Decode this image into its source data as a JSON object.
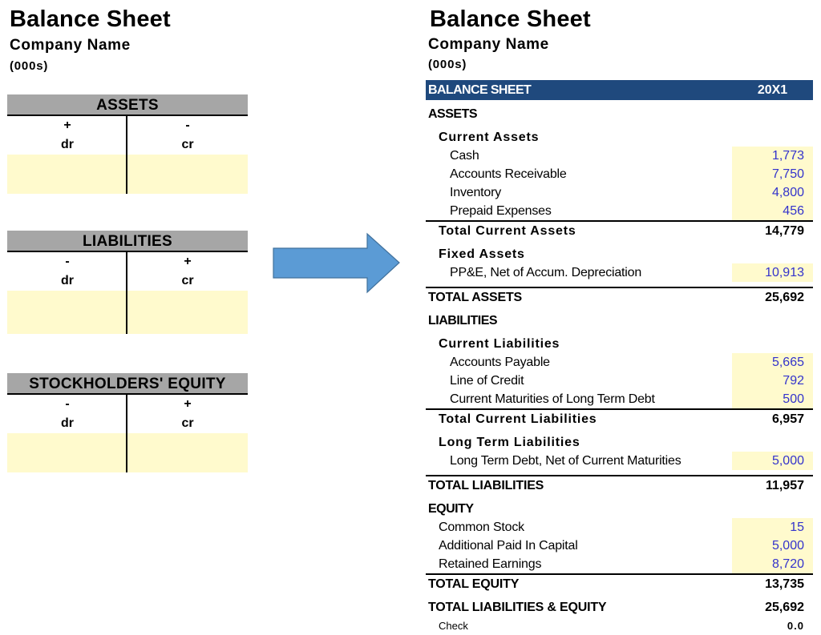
{
  "left": {
    "title": "Balance Sheet",
    "company": "Company Name",
    "units": "(000s)",
    "t_accounts": [
      {
        "name": "ASSETS",
        "dr_sign": "+",
        "cr_sign": "-",
        "dr_label": "dr",
        "cr_label": "cr"
      },
      {
        "name": "LIABILITIES",
        "dr_sign": "-",
        "cr_sign": "+",
        "dr_label": "dr",
        "cr_label": "cr"
      },
      {
        "name": "STOCKHOLDERS' EQUITY",
        "dr_sign": "-",
        "cr_sign": "+",
        "dr_label": "dr",
        "cr_label": "cr"
      }
    ]
  },
  "arrow": {
    "icon": "right-arrow-icon",
    "color": "#5b9bd5"
  },
  "right": {
    "title": "Balance Sheet",
    "company": "Company Name",
    "units": "(000s)",
    "header": {
      "label": "BALANCE SHEET",
      "period": "20X1",
      "color": "#1f497d"
    },
    "assets": {
      "label": "ASSETS",
      "current": {
        "label": "Current Assets",
        "items": [
          {
            "label": "Cash",
            "value": "1,773"
          },
          {
            "label": "Accounts Receivable",
            "value": "7,750"
          },
          {
            "label": "Inventory",
            "value": "4,800"
          },
          {
            "label": "Prepaid Expenses",
            "value": "456"
          }
        ],
        "total_label": "Total Current Assets",
        "total_value": "14,779"
      },
      "fixed": {
        "label": "Fixed Assets",
        "items": [
          {
            "label": "PP&E, Net of Accum. Depreciation",
            "value": "10,913"
          }
        ]
      },
      "total_label": "TOTAL ASSETS",
      "total_value": "25,692"
    },
    "liabilities": {
      "label": "LIABILITIES",
      "current": {
        "label": "Current Liabilities",
        "items": [
          {
            "label": "Accounts Payable",
            "value": "5,665"
          },
          {
            "label": "Line of Credit",
            "value": "792"
          },
          {
            "label": "Current Maturities of Long Term Debt",
            "value": "500"
          }
        ],
        "total_label": "Total Current Liabilities",
        "total_value": "6,957"
      },
      "long_term": {
        "label": "Long Term Liabilities",
        "items": [
          {
            "label": "Long Term Debt, Net of Current Maturities",
            "value": "5,000"
          }
        ]
      },
      "total_label": "TOTAL LIABILITIES",
      "total_value": "11,957"
    },
    "equity": {
      "label": "EQUITY",
      "items": [
        {
          "label": "Common Stock",
          "value": "15"
        },
        {
          "label": "Additional Paid In Capital",
          "value": "5,000"
        },
        {
          "label": "Retained Earnings",
          "value": "8,720"
        }
      ],
      "total_label": "TOTAL EQUITY",
      "total_value": "13,735"
    },
    "total_le_label": "TOTAL LIABILITIES & EQUITY",
    "total_le_value": "25,692",
    "check_label": "Check",
    "check_value": "0.0",
    "colors": {
      "input_fill": "#fffacd",
      "input_text": "#3333cc"
    }
  }
}
